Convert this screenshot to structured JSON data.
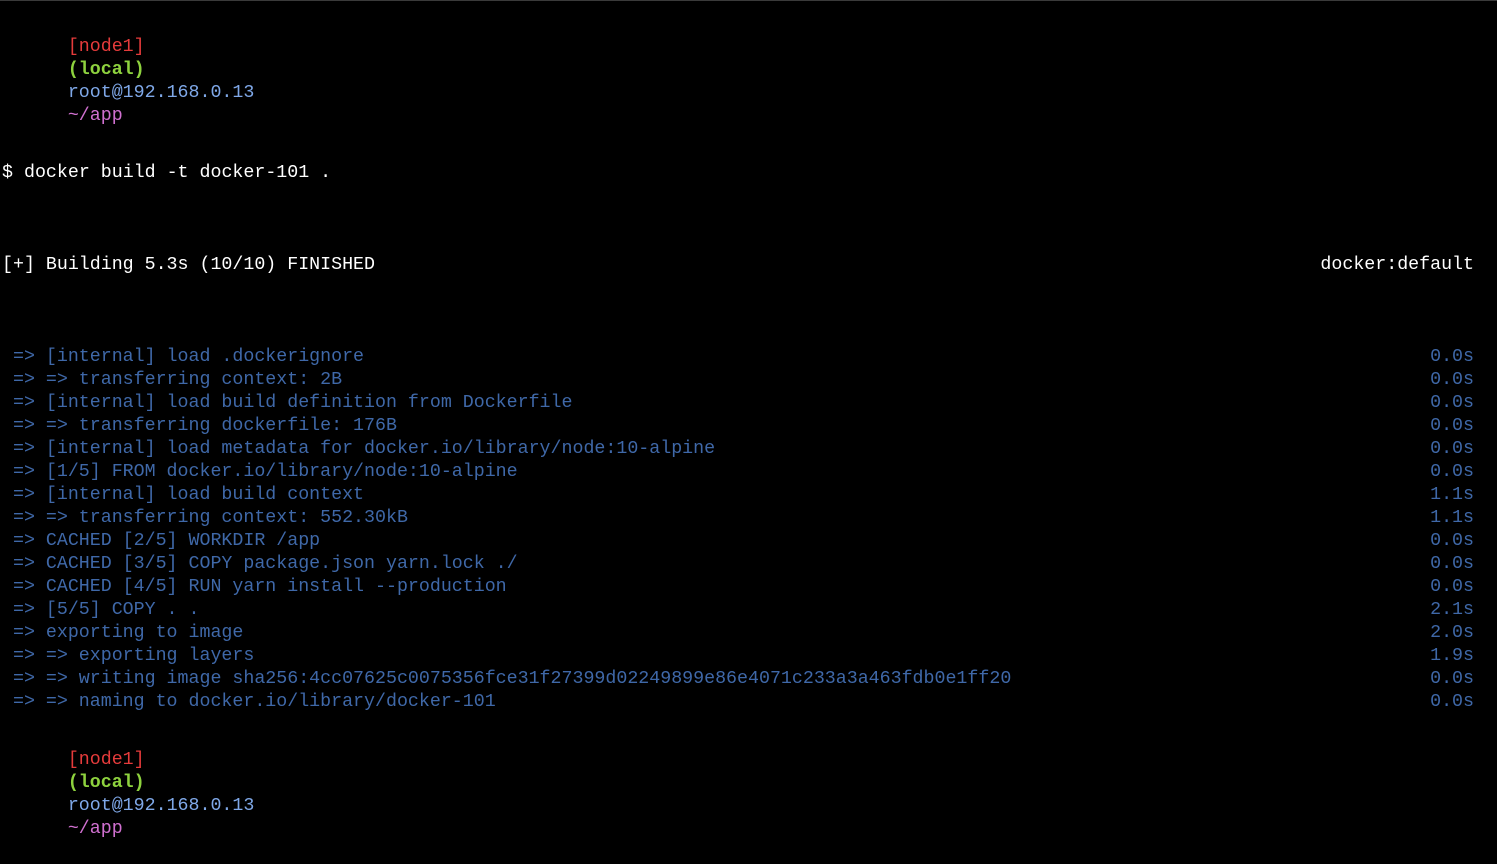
{
  "colors": {
    "background": "#000000",
    "node_tag": "#e53b3b",
    "local_tag": "#8ed23e",
    "host": "#7fa8e8",
    "cwd": "#d070d0",
    "output": "#ffffff",
    "build_step": "#3f68a8"
  },
  "prompt_top": {
    "node": "[node1]",
    "local": "(local)",
    "host": "root@192.168.0.13",
    "cwd": "~/app"
  },
  "command": {
    "symbol": "$",
    "text": "docker build -t docker-101 ."
  },
  "build_header": {
    "status": "[+] Building 5.3s (10/10) FINISHED",
    "builder": "docker:default"
  },
  "build_steps": [
    {
      "text": " => [internal] load .dockerignore",
      "time": "0.0s"
    },
    {
      "text": " => => transferring context: 2B",
      "time": "0.0s"
    },
    {
      "text": " => [internal] load build definition from Dockerfile",
      "time": "0.0s"
    },
    {
      "text": " => => transferring dockerfile: 176B",
      "time": "0.0s"
    },
    {
      "text": " => [internal] load metadata for docker.io/library/node:10-alpine",
      "time": "0.0s"
    },
    {
      "text": " => [1/5] FROM docker.io/library/node:10-alpine",
      "time": "0.0s"
    },
    {
      "text": " => [internal] load build context",
      "time": "1.1s"
    },
    {
      "text": " => => transferring context: 552.30kB",
      "time": "1.1s"
    },
    {
      "text": " => CACHED [2/5] WORKDIR /app",
      "time": "0.0s"
    },
    {
      "text": " => CACHED [3/5] COPY package.json yarn.lock ./",
      "time": "0.0s"
    },
    {
      "text": " => CACHED [4/5] RUN yarn install --production",
      "time": "0.0s"
    },
    {
      "text": " => [5/5] COPY . .",
      "time": "2.1s"
    },
    {
      "text": " => exporting to image",
      "time": "2.0s"
    },
    {
      "text": " => => exporting layers",
      "time": "1.9s"
    },
    {
      "text": " => => writing image sha256:4cc07625c0075356fce31f27399d02249899e86e4071c233a3a463fdb0e1ff20",
      "time": "0.0s"
    },
    {
      "text": " => => naming to docker.io/library/docker-101",
      "time": "0.0s"
    }
  ],
  "prompt_bottom": {
    "node": "[node1]",
    "local": "(local)",
    "host": "root@192.168.0.13",
    "cwd": "~/app"
  }
}
